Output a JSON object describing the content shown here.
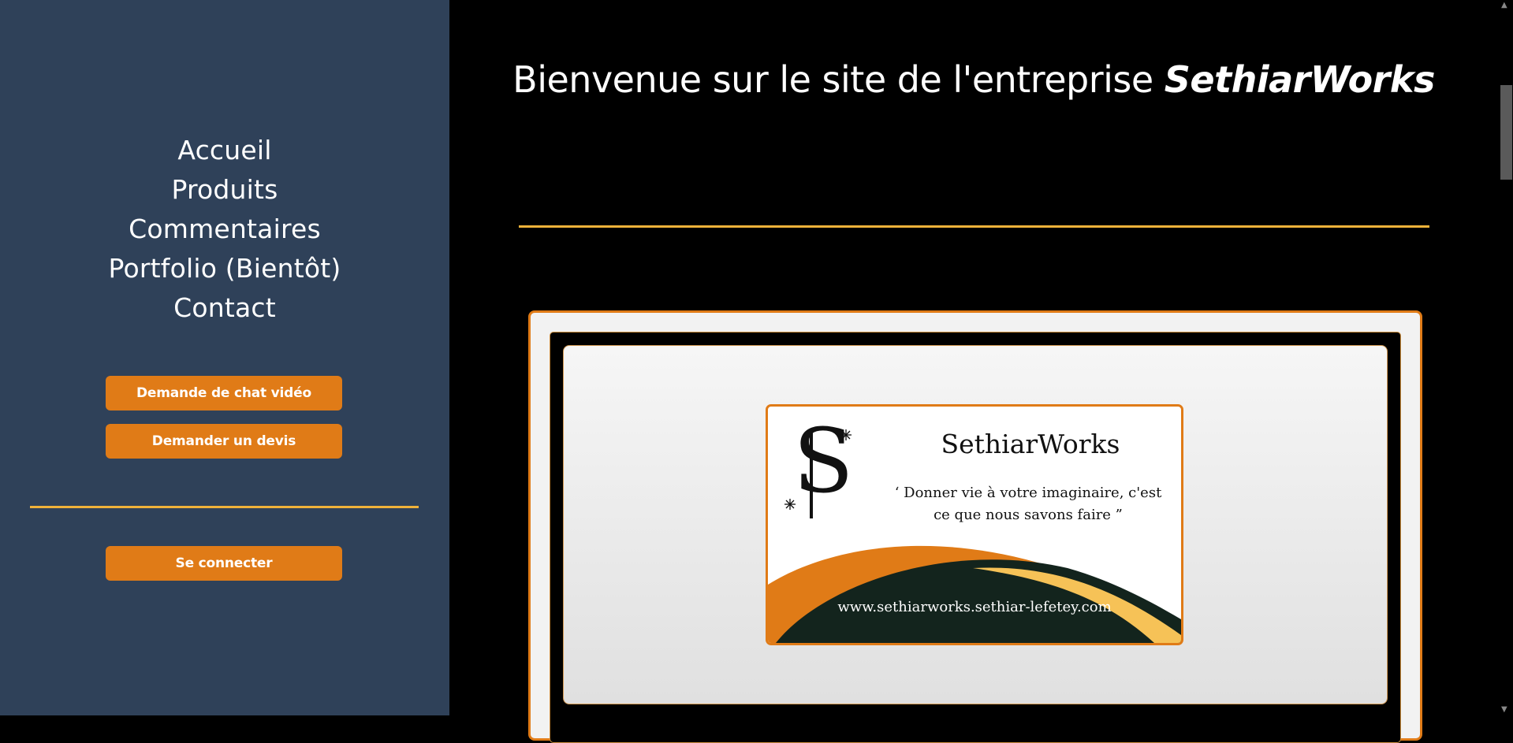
{
  "sidebar": {
    "nav": [
      "Accueil",
      "Produits",
      "Commentaires",
      "Portfolio (Bientôt)",
      "Contact"
    ],
    "video_chat_button": "Demande de chat vidéo",
    "quote_button": "Demander un devis",
    "login_button": "Se connecter"
  },
  "main": {
    "title_prefix": "Bienvenue sur le site de l'entreprise ",
    "title_brand": "SethiarWorks"
  },
  "card": {
    "logo_letter": "S",
    "name": "SethiarWorks",
    "tagline_line1": "‘ Donner vie à votre imaginaire, c'est",
    "tagline_line2": "ce que nous savons faire ”",
    "url": "www.sethiarworks.sethiar-lefetey.com"
  },
  "colors": {
    "sidebar_bg": "#2f4159",
    "accent_orange": "#e07b17",
    "divider_gold": "#f0b23a",
    "card_dark_green": "#13241d",
    "card_light_orange": "#f6c257"
  }
}
